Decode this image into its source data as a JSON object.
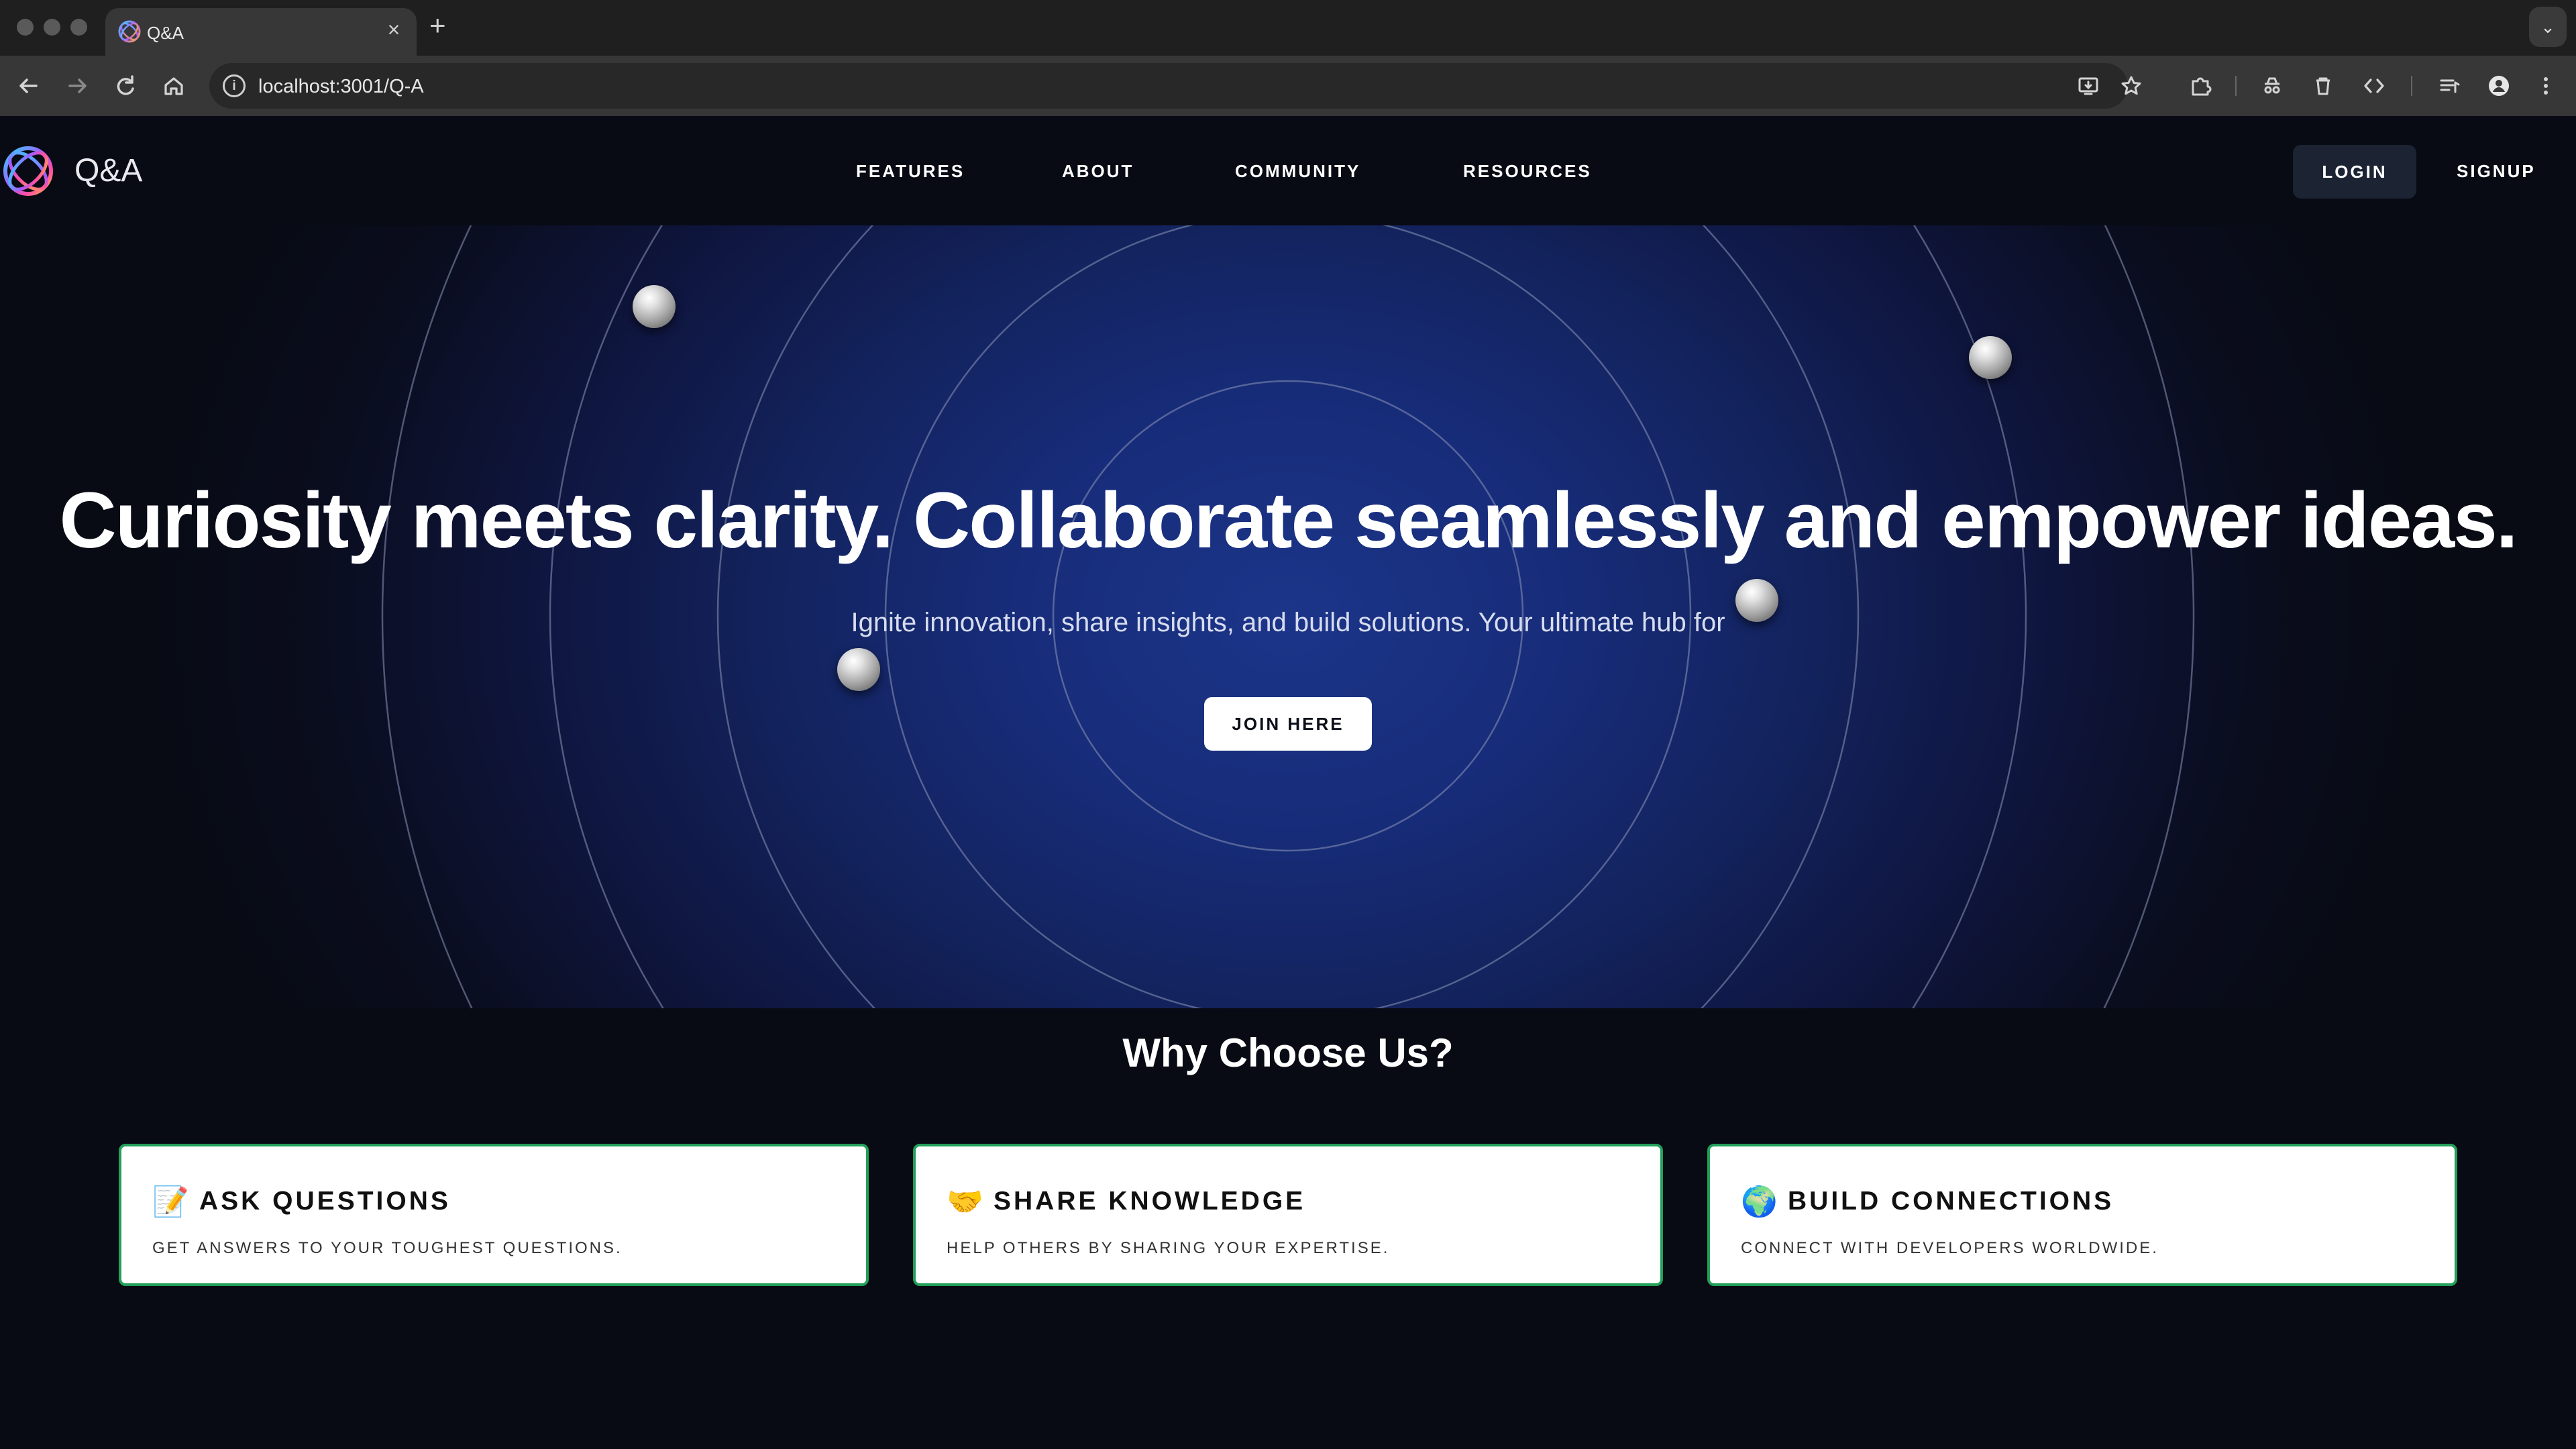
{
  "browser": {
    "tab": {
      "title": "Q&A",
      "close_icon": "×"
    },
    "new_tab_icon": "+",
    "tab_menu_icon": "⌄",
    "address": "localhost:3001/Q-A",
    "info_icon": "i"
  },
  "navbar": {
    "logo_text": "Q&A",
    "links": [
      "FEATURES",
      "ABOUT",
      "COMMUNITY",
      "RESOURCES"
    ],
    "login": "LOGIN",
    "signup": "SIGNUP"
  },
  "hero": {
    "title": "Curiosity meets clarity. Collaborate seamlessly and empower ideas.",
    "subtitle": "Ignite innovation, share insights, and build solutions. Your ultimate hub for",
    "cta": "JOIN HERE"
  },
  "features": {
    "title": "Why Choose Us?",
    "cards": [
      {
        "emoji": "📝",
        "title": "ASK QUESTIONS",
        "desc": "GET ANSWERS TO YOUR TOUGHEST QUESTIONS."
      },
      {
        "emoji": "🤝",
        "title": "SHARE KNOWLEDGE",
        "desc": "HELP OTHERS BY SHARING YOUR EXPERTISE."
      },
      {
        "emoji": "🌍",
        "title": "BUILD CONNECTIONS",
        "desc": "CONNECT WITH DEVELOPERS WORLDWIDE."
      }
    ]
  },
  "colors": {
    "page_bg": "#080b14",
    "hero_center": "#1c3589",
    "card_border": "#22a05a",
    "login_bg": "#1c2433"
  }
}
